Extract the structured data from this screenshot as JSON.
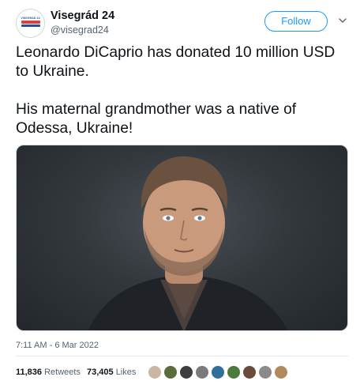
{
  "author": {
    "display_name": "Visegrád 24",
    "handle": "@visegrad24",
    "avatar_icon": "visegrad-logo-icon"
  },
  "follow_label": "Follow",
  "tweet": {
    "line1": "Leonardo DiCaprio has donated 10 million USD to Ukraine.",
    "line2": "His maternal grandmother was a native of Odessa, Ukraine!"
  },
  "timestamp": "7:11 AM - 6 Mar 2022",
  "stats": {
    "retweets_count": "11,836",
    "retweets_label": "Retweets",
    "likes_count": "73,405",
    "likes_label": "Likes"
  },
  "colors": {
    "accent": "#1d9bf0",
    "text": "#0f1419",
    "muted": "#536471"
  },
  "likers": [
    {
      "color": "#c9b7a4"
    },
    {
      "color": "#5a6b3c"
    },
    {
      "color": "#3d3d3d"
    },
    {
      "color": "#7a7a7a"
    },
    {
      "color": "#2f6f9a"
    },
    {
      "color": "#4c7a3a"
    },
    {
      "color": "#6b4a3a"
    },
    {
      "color": "#8a8a8a"
    },
    {
      "color": "#b08a5a"
    }
  ]
}
